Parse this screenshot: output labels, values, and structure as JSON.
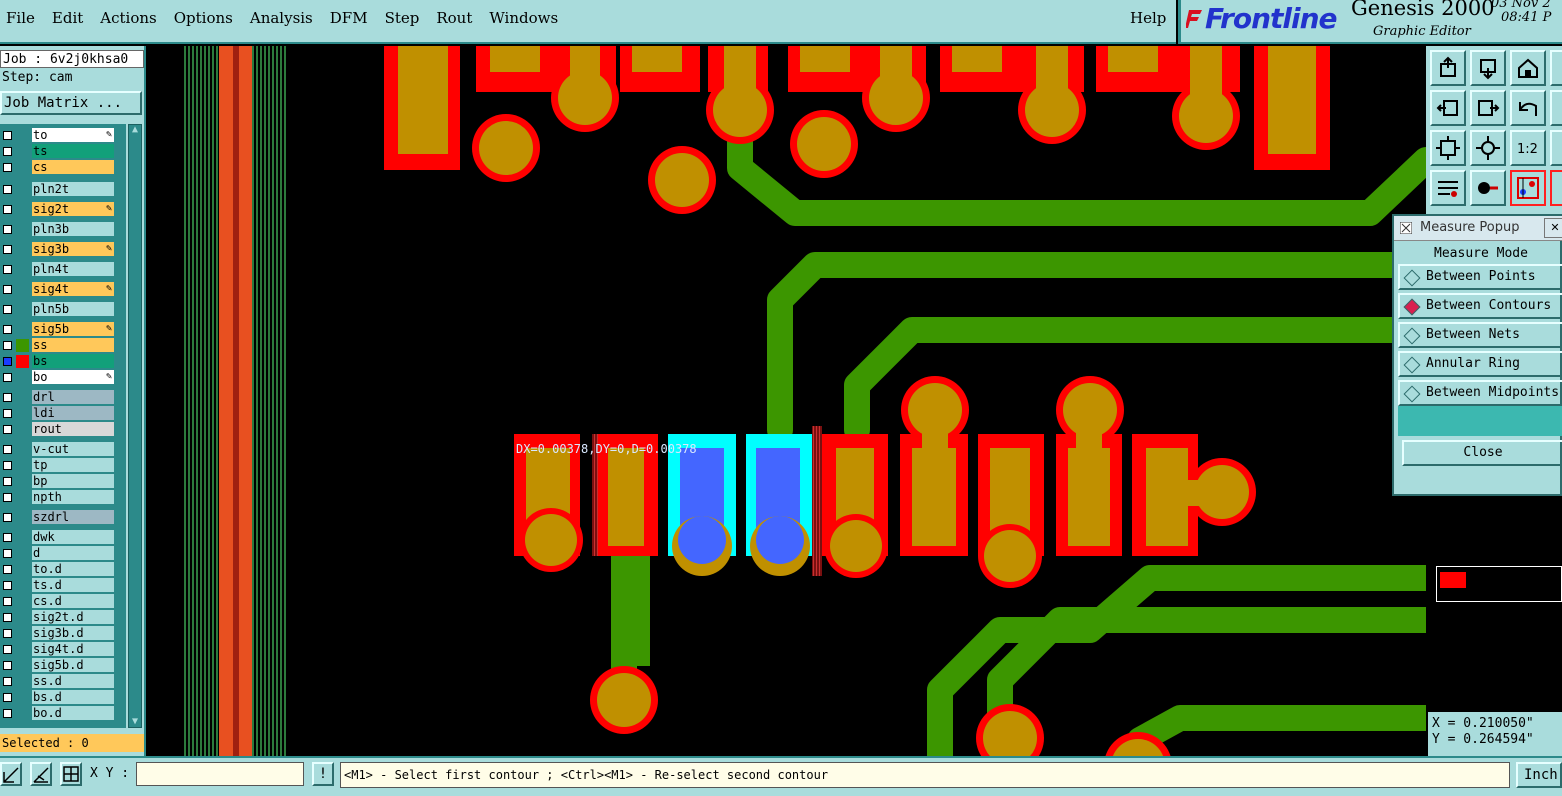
{
  "menu": [
    "File",
    "Edit",
    "Actions",
    "Options",
    "Analysis",
    "DFM",
    "Step",
    "Rout",
    "Windows"
  ],
  "help": "Help",
  "brand": {
    "logo": "Frontline",
    "product": "Genesis 2000",
    "subtitle": "Graphic Editor",
    "date": "03 Nov 2",
    "time": "08:41 P"
  },
  "left": {
    "job": "Job : 6v2j0khsa0",
    "step": "Step: cam",
    "job_matrix": "Job Matrix ...",
    "selected": "Selected : 0"
  },
  "layers": [
    {
      "name": "to",
      "bg": "#ffffff"
    },
    {
      "name": "ts",
      "bg": "#12a07a"
    },
    {
      "name": "cs",
      "bg": "#ffc85a"
    },
    {
      "name": "pln2t",
      "bg": "#a9dcdc"
    },
    {
      "name": "sig2t",
      "bg": "#ffc85a"
    },
    {
      "name": "pln3b",
      "bg": "#a9dcdc"
    },
    {
      "name": "sig3b",
      "bg": "#ffc85a"
    },
    {
      "name": "pln4t",
      "bg": "#a9dcdc"
    },
    {
      "name": "sig4t",
      "bg": "#ffc85a"
    },
    {
      "name": "pln5b",
      "bg": "#a9dcdc"
    },
    {
      "name": "sig5b",
      "bg": "#ffc85a"
    },
    {
      "name": "ss",
      "bg": "#ffc85a"
    },
    {
      "name": "bs",
      "bg": "#12a07a"
    },
    {
      "name": "bo",
      "bg": "#ffffff"
    },
    {
      "name": "drl",
      "bg": "#9db8c4"
    },
    {
      "name": "ldi",
      "bg": "#9db8c4"
    },
    {
      "name": "rout",
      "bg": "#d8d8d8"
    },
    {
      "name": "v-cut",
      "bg": "#a9dcdc"
    },
    {
      "name": "tp",
      "bg": "#a9dcdc"
    },
    {
      "name": "bp",
      "bg": "#a9dcdc"
    },
    {
      "name": "npth",
      "bg": "#a9dcdc"
    },
    {
      "name": "szdrl",
      "bg": "#9db8c4"
    },
    {
      "name": "dwk",
      "bg": "#a9dcdc"
    },
    {
      "name": "d",
      "bg": "#a9dcdc"
    },
    {
      "name": "to.d",
      "bg": "#a9dcdc"
    },
    {
      "name": "ts.d",
      "bg": "#a9dcdc"
    },
    {
      "name": "cs.d",
      "bg": "#a9dcdc"
    },
    {
      "name": "sig2t.d",
      "bg": "#a9dcdc"
    },
    {
      "name": "sig3b.d",
      "bg": "#a9dcdc"
    },
    {
      "name": "sig4t.d",
      "bg": "#a9dcdc"
    },
    {
      "name": "sig5b.d",
      "bg": "#a9dcdc"
    },
    {
      "name": "ss.d",
      "bg": "#a9dcdc"
    },
    {
      "name": "bs.d",
      "bg": "#a9dcdc"
    },
    {
      "name": "bo.d",
      "bg": "#a9dcdc"
    }
  ],
  "canvas": {
    "measure_readout": "DX=0.00378,DY=0,D=0.00378"
  },
  "popup": {
    "title": "Measure Popup",
    "mode_title": "Measure Mode",
    "modes": [
      "Between Points",
      "Between Contours",
      "Between Nets",
      "Annular Ring",
      "Between Midpoints"
    ],
    "selected_mode": "Between Contours",
    "close": "Close"
  },
  "coords": {
    "x": "X = 0.210050\"",
    "y": "Y = 0.264594\""
  },
  "status": {
    "xy_label": "X Y :",
    "xy_value": "",
    "prompt": "<M1> - Select first contour ; <Ctrl><M1> - Re-select second contour",
    "warn": "!",
    "units": "Inch"
  },
  "colors": {
    "ui_bg": "#a9dcdc",
    "pad_copper": "#c09000",
    "pad_mask": "#ff0000",
    "trace": "#3c9600",
    "highlight": "#00ffff",
    "selected_pad": "#4466ff"
  }
}
